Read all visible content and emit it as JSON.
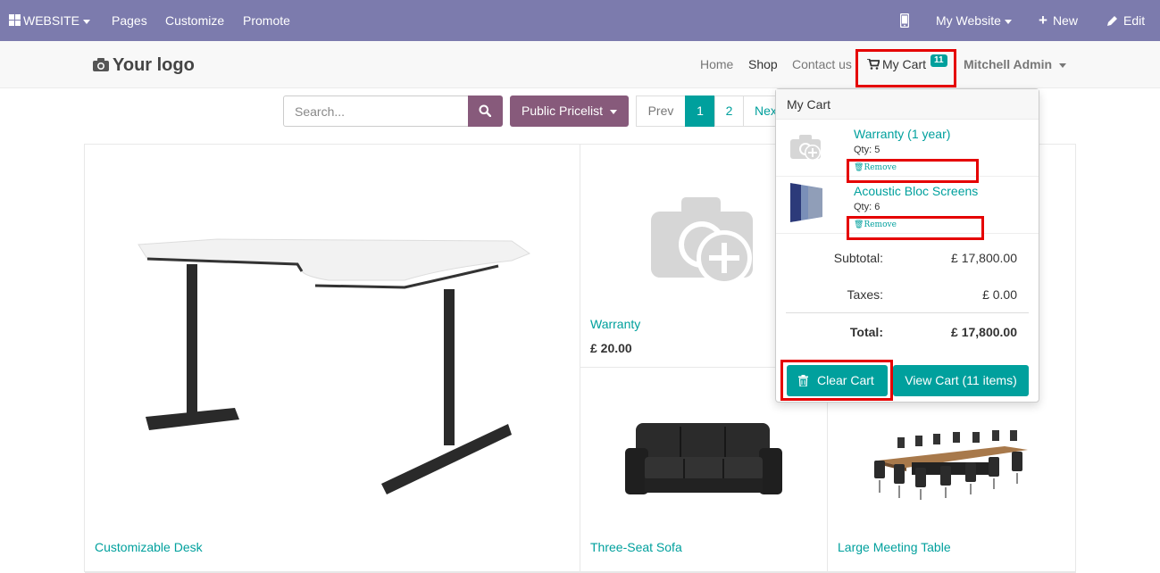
{
  "adminbar": {
    "website_menu": "WEBSITE",
    "pages": "Pages",
    "customize": "Customize",
    "promote": "Promote",
    "my_website": "My Website",
    "new": "New",
    "edit": "Edit"
  },
  "header": {
    "logo": "Your logo",
    "nav": {
      "home": "Home",
      "shop": "Shop",
      "contact": "Contact us",
      "cart": "My Cart",
      "cart_count": "11",
      "user": "Mitchell Admin"
    }
  },
  "toolbar": {
    "search_placeholder": "Search...",
    "pricelist": "Public Pricelist",
    "pager": {
      "prev": "Prev",
      "page1": "1",
      "page2": "2",
      "next": "Next"
    }
  },
  "products": [
    {
      "name": "Customizable Desk"
    },
    {
      "name": "Warranty",
      "price": "£ 20.00"
    },
    {
      "name": "Three-Seat Sofa"
    },
    {
      "name": "Large Meeting Table"
    }
  ],
  "cart_popover": {
    "title": "My Cart",
    "lines": [
      {
        "name": "Warranty (1 year)",
        "qty": "Qty: 5",
        "remove": "Remove"
      },
      {
        "name": "Acoustic Bloc Screens",
        "qty": "Qty: 6",
        "remove": "Remove"
      }
    ],
    "subtotal_label": "Subtotal:",
    "subtotal": "£ 17,800.00",
    "taxes_label": "Taxes:",
    "taxes": "£ 0.00",
    "total_label": "Total:",
    "total": "£ 17,800.00",
    "clear_cart": "Clear Cart",
    "view_cart": "View Cart (11 items)"
  },
  "colors": {
    "admin_bar": "#7c7bad",
    "primary": "#875a7b",
    "accent": "#00a09d",
    "highlight": "#e50000"
  }
}
